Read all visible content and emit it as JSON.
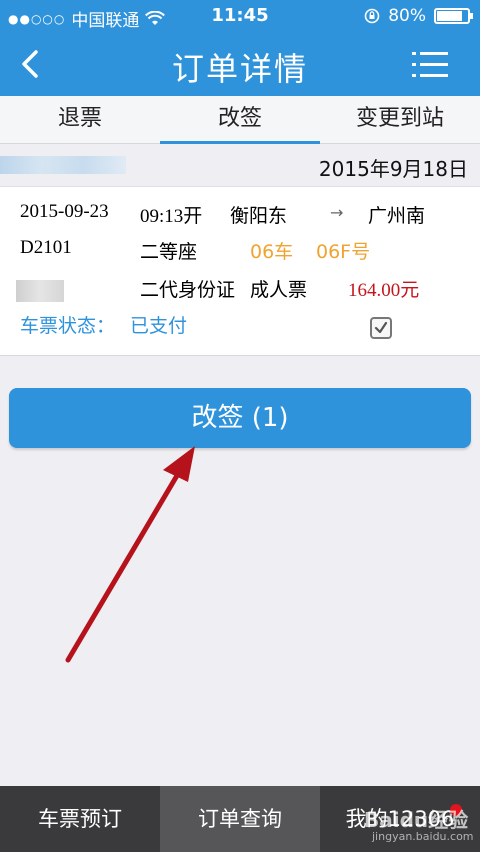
{
  "status_bar": {
    "carrier": "中国联通",
    "time": "11:45",
    "battery": "80%",
    "battery_level": 0.8
  },
  "nav": {
    "back_icon": "back-chevron-icon",
    "title": "订单详情",
    "menu_icon": "menu-icon"
  },
  "tabs": [
    {
      "label": "退票",
      "active": false
    },
    {
      "label": "改签",
      "active": true
    },
    {
      "label": "变更到站",
      "active": false
    }
  ],
  "order": {
    "date": "2015年9月18日",
    "ticket": {
      "travel_date": "2015-09-23",
      "departure_time": "09:13开",
      "from_station": "衡阳东",
      "arrow": "→",
      "to_station": "广州南",
      "train_no": "D2101",
      "seat_class": "二等座",
      "car": "06车",
      "seat": "06F号",
      "id_type": "二代身份证",
      "ticket_type": "成人票",
      "price": "164.00元",
      "status_label": "车票状态：",
      "status_value": "已支付",
      "selected": true
    }
  },
  "action_button": {
    "label": "改签 (1)"
  },
  "bottom_nav": [
    {
      "label": "车票预订",
      "active": false
    },
    {
      "label": "订单查询",
      "active": true
    },
    {
      "label": "我的12306",
      "active": false
    }
  ],
  "watermark": {
    "brand": "Baidu经验",
    "url": "jingyan.baidu.com"
  },
  "colors": {
    "primary": "#2f93dc",
    "accent_orange": "#f0a430",
    "price_red": "#c4151c",
    "bottom_bar": "#3a3a3c",
    "annotation_arrow": "#b5121b"
  }
}
